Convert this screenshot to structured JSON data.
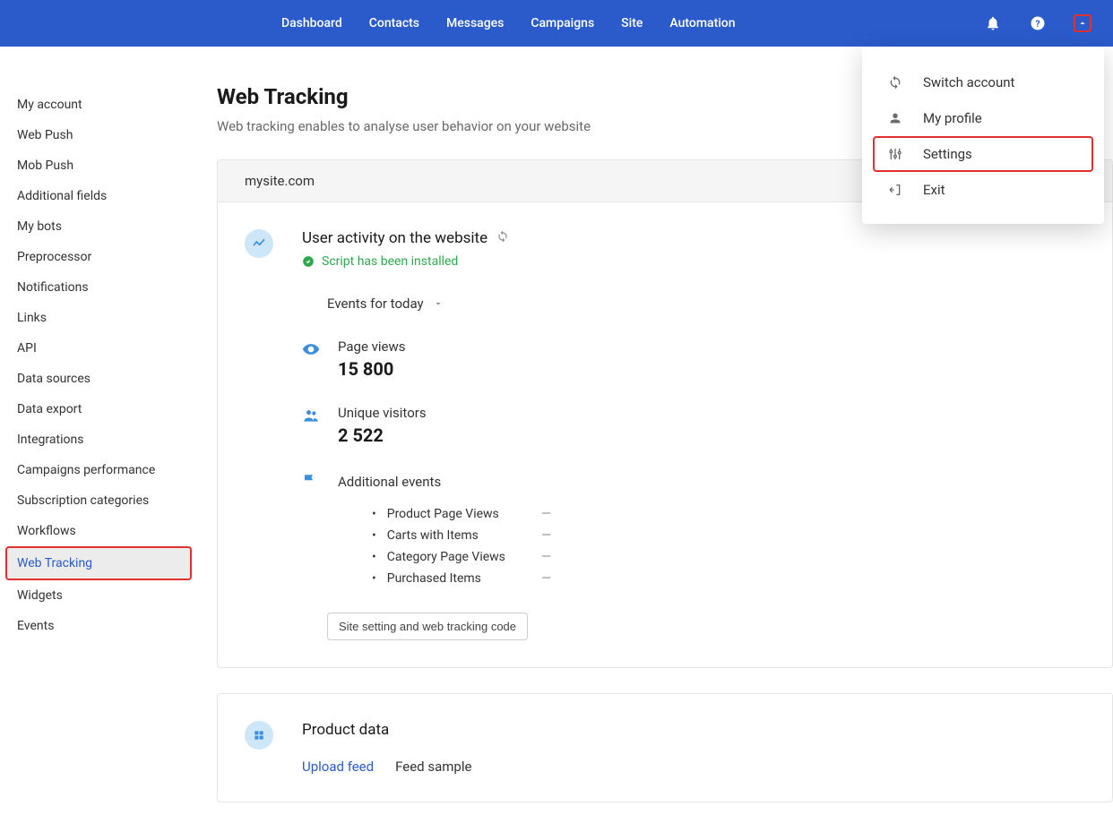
{
  "topnav": {
    "items": [
      "Dashboard",
      "Contacts",
      "Messages",
      "Campaigns",
      "Site",
      "Automation"
    ]
  },
  "user_menu": {
    "items": [
      {
        "label": "Switch account"
      },
      {
        "label": "My profile"
      },
      {
        "label": "Settings"
      },
      {
        "label": "Exit"
      }
    ]
  },
  "sidebar": {
    "items": [
      "My account",
      "Web Push",
      "Mob Push",
      "Additional fields",
      "My bots",
      "Preprocessor",
      "Notifications",
      "Links",
      "API",
      "Data sources",
      "Data export",
      "Integrations",
      "Campaigns performance",
      "Subscription categories",
      "Workflows",
      "Web Tracking",
      "Widgets",
      "Events"
    ],
    "active_index": 15
  },
  "page": {
    "title": "Web Tracking",
    "subtitle": "Web tracking enables to analyse user behavior on your website"
  },
  "site": {
    "domain": "mysite.com"
  },
  "activity": {
    "title": "User activity on the website",
    "script_status": "Script has been installed",
    "period_label": "Events for today",
    "page_views": {
      "label": "Page views",
      "value": "15 800"
    },
    "unique_visitors": {
      "label": "Unique visitors",
      "value": "2 522"
    },
    "additional_label": "Additional events",
    "additional_events": [
      {
        "name": "Product Page Views",
        "value": "—"
      },
      {
        "name": "Carts with Items",
        "value": "—"
      },
      {
        "name": "Category Page Views",
        "value": "—"
      },
      {
        "name": "Purchased Items",
        "value": "—"
      }
    ],
    "settings_button": "Site setting and web tracking code"
  },
  "product": {
    "title": "Product data",
    "upload_label": "Upload feed",
    "sample_label": "Feed sample"
  }
}
